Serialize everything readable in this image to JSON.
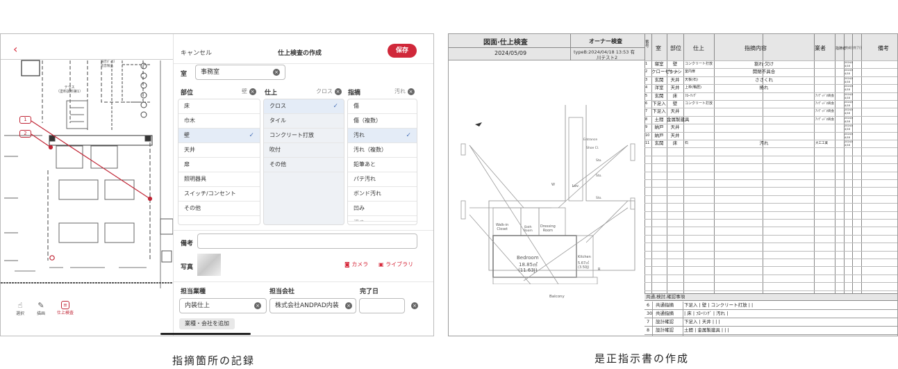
{
  "left": {
    "back_icon": "chevron-left-icon",
    "form": {
      "cancel": "キャンセル",
      "title": "仕上検査の作成",
      "save": "保存",
      "room_label": "室",
      "room_value": "事務室",
      "col1": {
        "header": "部位",
        "selected": "壁",
        "items": [
          "床",
          "巾木",
          "壁",
          "天井",
          "扉",
          "照明器具",
          "スイッチ/コンセント",
          "その他"
        ]
      },
      "col2": {
        "header": "仕上",
        "selected": "クロス",
        "items": [
          "クロス",
          "タイル",
          "コンクリート打放",
          "吹付",
          "その他"
        ]
      },
      "col3": {
        "header": "指摘",
        "selected": "汚れ",
        "items": [
          "傷",
          "傷（複数）",
          "汚れ",
          "汚れ（複数）",
          "鉛筆あと",
          "パテ汚れ",
          "ボンド汚れ",
          "凹み",
          "浮き"
        ]
      },
      "remarks_label": "備考",
      "photo_label": "写真",
      "camera": "カメラ",
      "library": "ライブラリ",
      "trade_label": "担当業種",
      "company_label": "担当会社",
      "due_label": "完了日",
      "trade_value": "内装仕上",
      "company_value": "株式会社ANDPAD内装",
      "add_button": "業種・会社を追加"
    },
    "toolbar": [
      {
        "label": "選択",
        "icon": "hand-pointer-icon"
      },
      {
        "label": "描画",
        "icon": "pencil-icon"
      },
      {
        "label": "仕上検査",
        "icon": "inspection-icon"
      }
    ],
    "markers": [
      "1",
      "2"
    ],
    "plan_labels": {
      "a": "テラス\n（塗料試料第1）",
      "b": "展示ﾎﾞｯｸｽ\n遮音製品"
    }
  },
  "right": {
    "header": {
      "title": "図面·仕上検査",
      "date": "2024/05/09",
      "owner_label": "オーナー検査",
      "owner_info": "typeB:2024/04/18 13:53 有",
      "owner_name": "川テスト2",
      "col_no": "番号",
      "col_room": "室",
      "col_part": "部位",
      "col_finish": "仕上",
      "col_content": "指摘内容",
      "col_vendor": "業者",
      "col_date1": "指摘者",
      "col_date2": "完成日",
      "col_date3": "完了日",
      "col_remarks": "備考"
    },
    "rows": [
      {
        "no": "1",
        "room": "寝室",
        "part": "壁",
        "finish": "コンクリート打放",
        "content": "割れ·欠け",
        "vendor": "",
        "d2": "2024/5\n4/18"
      },
      {
        "no": "2",
        "room": "クローゼット",
        "part": "サッシ",
        "finish": "室内扉",
        "content": "開閉不具合",
        "vendor": "",
        "d2": "2024/5\n4/18"
      },
      {
        "no": "3",
        "room": "玄関",
        "part": "天井",
        "finish": "天板(石)",
        "content": "ささくれ",
        "vendor": "",
        "d2": "2024/5\n4/18"
      },
      {
        "no": "4",
        "room": "洋室",
        "part": "天井",
        "finish": "上枠(鴨居)",
        "content": "捲れ",
        "vendor": "",
        "d2": "2024/5\n4/18"
      },
      {
        "no": "5",
        "room": "玄関",
        "part": "床",
        "finish": "ﾌﾛｰﾘﾝｸﾞ",
        "content": "",
        "vendor": "ｱﾝﾃﾞｨﾄﾞﾈ商会",
        "d2": "2024/5\n4/18"
      },
      {
        "no": "6",
        "room": "下足入",
        "part": "壁",
        "finish": "コンクリート打放",
        "content": "",
        "vendor": "ｱﾝﾃﾞｨﾄﾞﾈ商会",
        "d2": "2024/5\n4/18"
      },
      {
        "no": "7",
        "room": "下足入",
        "part": "天井",
        "finish": "",
        "content": "",
        "vendor": "ｱﾝﾃﾞｨﾄﾞﾈ商会",
        "d2": "2024/5\n4/18"
      },
      {
        "no": "8",
        "room": "土間",
        "part": "金属製建具",
        "finish": "",
        "content": "",
        "vendor": "ｱﾝﾃﾞｨﾄﾞﾈ商会",
        "d2": "2024/5\n4/18"
      },
      {
        "no": "9",
        "room": "納戸",
        "part": "天井",
        "finish": "",
        "content": "",
        "vendor": "",
        "d2": "2024/5\n4/18"
      },
      {
        "no": "10",
        "room": "納戸",
        "part": "天井",
        "finish": "",
        "content": "",
        "vendor": "",
        "d2": "2024/5\n4/18"
      },
      {
        "no": "11",
        "room": "玄関",
        "part": "床",
        "finish": "石",
        "content": "汚れ",
        "vendor": "大工工業",
        "d2": "2024/5\n4/18"
      }
    ],
    "plan": {
      "walkin": "Walk-in\nCloset",
      "bath": "Bath\nRoom",
      "dressing": "Dressing\nRoom",
      "bedroom": "Bedroom",
      "bedroom_area1": "18.85㎡",
      "bedroom_area2": "(11.63J)",
      "kitchen": "Kitchen",
      "kitchen_area1": "5.67㎡",
      "kitchen_area2": "(3.50J)",
      "balcony": "Balcony",
      "entrance": "Entrance",
      "shoecl": "Shoe Cl.",
      "sto1": "Sto.",
      "sto2": "Sto.",
      "sto3": "Sto.",
      "w": "W",
      "lav": "Lav.",
      "r": "R"
    },
    "footer": {
      "title": "共通,検討,確認事項",
      "rows": [
        {
          "no": "6",
          "label": "共通指摘",
          "text": "下足入 | 壁 | コンクリート打放 | |"
        },
        {
          "no": "30",
          "label": "共通指摘",
          "text": "| 床 | ﾌﾛｰﾘﾝｸﾞ | 汚れ |"
        },
        {
          "no": "7",
          "label": "設計確認",
          "text": "下足入 | 天井 | | |"
        },
        {
          "no": "8",
          "label": "設計確認",
          "text": "土間 | 金属製建具 | | |"
        }
      ]
    }
  },
  "captions": {
    "left": "指摘箇所の記録",
    "right": "是正指示書の作成"
  },
  "colors": {
    "accent": "#d0283a",
    "selected": "#e4ecf7",
    "check": "#4a72b8"
  }
}
